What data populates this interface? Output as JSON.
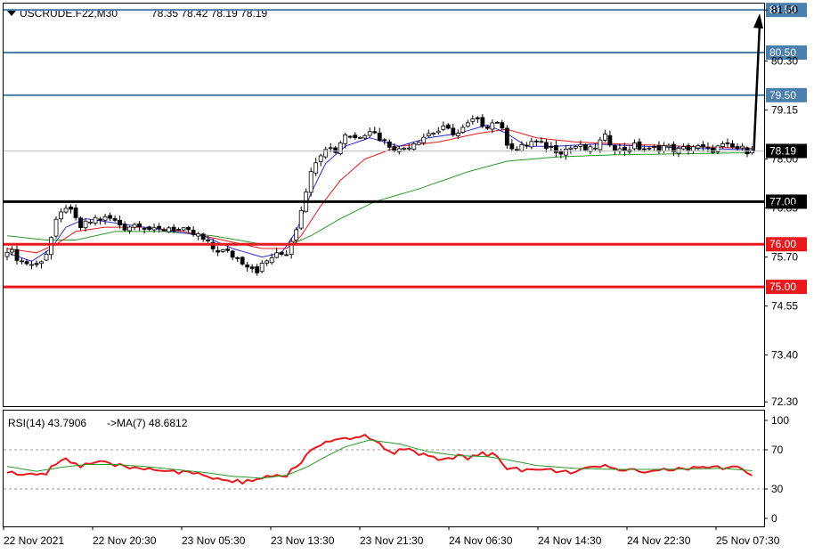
{
  "header": {
    "symbol": "USCRUDE.F22,M30",
    "ohlc": "78.35 78.42 78.19 78.19"
  },
  "rsi_header": {
    "label": "RSI(14) 43.7906",
    "ma_label": "->MA(7) 48.6812"
  },
  "colors": {
    "resistance": "#4a7fae",
    "pivot": "#000000",
    "support": "#e8191c",
    "ma_fast": "#2b2bd6",
    "ma_mid": "#e8191c",
    "ma_slow": "#2a9a2a",
    "rsi": "#e8191c",
    "rsi_ma": "#2a9a2a"
  },
  "chart_data": [
    {
      "type": "candlestick",
      "y_ticks": [
        "81.50",
        "80.30",
        "79.15",
        "78.00",
        "76.85",
        "75.70",
        "74.55",
        "73.40",
        "72.30"
      ],
      "ylim": [
        72.2,
        81.65
      ],
      "x_tick_labels": [
        "22 Nov 2021",
        "22 Nov 20:30",
        "23 Nov 05:30",
        "23 Nov 13:30",
        "23 Nov 21:30",
        "24 Nov 06:30",
        "24 Nov 14:30",
        "24 Nov 22:30",
        "25 Nov 07:30"
      ],
      "levels": [
        {
          "label": "81.50",
          "value": 81.5,
          "kind": "resistance"
        },
        {
          "label": "80.50",
          "value": 80.5,
          "kind": "resistance"
        },
        {
          "label": "79.50",
          "value": 79.5,
          "kind": "resistance"
        },
        {
          "label": "77.00",
          "value": 77.0,
          "kind": "pivot"
        },
        {
          "label": "76.00",
          "value": 76.0,
          "kind": "support"
        },
        {
          "label": "75.00",
          "value": 75.0,
          "kind": "support"
        }
      ],
      "current_price": {
        "label": "78.19",
        "value": 78.19
      },
      "forecast_arrow": {
        "from": 78.19,
        "to": 81.5
      },
      "close_path": [
        [
          0,
          75.9
        ],
        [
          3,
          75.6
        ],
        [
          6,
          75.5
        ],
        [
          8,
          75.8
        ],
        [
          10,
          76.5
        ],
        [
          12,
          76.9
        ],
        [
          15,
          76.4
        ],
        [
          18,
          76.6
        ],
        [
          21,
          76.6
        ],
        [
          24,
          76.4
        ],
        [
          27,
          76.5
        ],
        [
          30,
          76.3
        ],
        [
          33,
          76.4
        ],
        [
          36,
          76.3
        ],
        [
          39,
          76.2
        ],
        [
          42,
          75.9
        ],
        [
          45,
          75.8
        ],
        [
          48,
          75.6
        ],
        [
          51,
          75.4
        ],
        [
          54,
          75.7
        ],
        [
          57,
          75.8
        ],
        [
          59,
          76.4
        ],
        [
          61,
          77.3
        ],
        [
          63,
          78.0
        ],
        [
          65,
          78.3
        ],
        [
          67,
          78.2
        ],
        [
          69,
          78.6
        ],
        [
          71,
          78.5
        ],
        [
          74,
          78.7
        ],
        [
          77,
          78.4
        ],
        [
          80,
          78.2
        ],
        [
          83,
          78.4
        ],
        [
          86,
          78.6
        ],
        [
          89,
          78.7
        ],
        [
          92,
          78.6
        ],
        [
          95,
          78.9
        ],
        [
          98,
          78.8
        ],
        [
          100,
          78.9
        ],
        [
          102,
          78.4
        ],
        [
          104,
          78.2
        ],
        [
          107,
          78.4
        ],
        [
          110,
          78.3
        ],
        [
          113,
          78.2
        ],
        [
          116,
          78.3
        ],
        [
          119,
          78.2
        ],
        [
          122,
          78.5
        ],
        [
          125,
          78.2
        ],
        [
          128,
          78.3
        ],
        [
          131,
          78.2
        ],
        [
          134,
          78.3
        ],
        [
          137,
          78.2
        ],
        [
          140,
          78.3
        ],
        [
          143,
          78.2
        ],
        [
          146,
          78.3
        ],
        [
          149,
          78.25
        ],
        [
          152,
          78.19
        ]
      ],
      "ma_fast_path": [
        [
          0,
          75.8
        ],
        [
          5,
          75.6
        ],
        [
          9,
          75.9
        ],
        [
          12,
          76.4
        ],
        [
          16,
          76.6
        ],
        [
          22,
          76.5
        ],
        [
          28,
          76.4
        ],
        [
          34,
          76.3
        ],
        [
          40,
          76.2
        ],
        [
          46,
          75.9
        ],
        [
          52,
          75.7
        ],
        [
          56,
          75.8
        ],
        [
          59,
          76.3
        ],
        [
          62,
          77.2
        ],
        [
          65,
          77.9
        ],
        [
          69,
          78.3
        ],
        [
          74,
          78.5
        ],
        [
          80,
          78.3
        ],
        [
          86,
          78.5
        ],
        [
          92,
          78.6
        ],
        [
          98,
          78.8
        ],
        [
          102,
          78.6
        ],
        [
          106,
          78.3
        ],
        [
          112,
          78.3
        ],
        [
          120,
          78.35
        ],
        [
          130,
          78.3
        ],
        [
          140,
          78.25
        ],
        [
          152,
          78.22
        ]
      ],
      "ma_mid_path": [
        [
          0,
          75.9
        ],
        [
          6,
          75.8
        ],
        [
          10,
          76.0
        ],
        [
          14,
          76.3
        ],
        [
          20,
          76.4
        ],
        [
          28,
          76.4
        ],
        [
          36,
          76.3
        ],
        [
          44,
          76.1
        ],
        [
          52,
          75.9
        ],
        [
          57,
          75.9
        ],
        [
          60,
          76.2
        ],
        [
          64,
          76.9
        ],
        [
          68,
          77.5
        ],
        [
          73,
          78.0
        ],
        [
          80,
          78.3
        ],
        [
          88,
          78.4
        ],
        [
          96,
          78.6
        ],
        [
          102,
          78.7
        ],
        [
          108,
          78.5
        ],
        [
          116,
          78.4
        ],
        [
          126,
          78.35
        ],
        [
          138,
          78.3
        ],
        [
          152,
          78.25
        ]
      ],
      "ma_slow_path": [
        [
          0,
          76.2
        ],
        [
          8,
          76.1
        ],
        [
          14,
          76.1
        ],
        [
          22,
          76.3
        ],
        [
          32,
          76.3
        ],
        [
          42,
          76.2
        ],
        [
          52,
          76.0
        ],
        [
          58,
          76.0
        ],
        [
          62,
          76.2
        ],
        [
          68,
          76.6
        ],
        [
          75,
          77.0
        ],
        [
          84,
          77.3
        ],
        [
          94,
          77.7
        ],
        [
          102,
          77.95
        ],
        [
          112,
          78.05
        ],
        [
          124,
          78.1
        ],
        [
          136,
          78.12
        ],
        [
          152,
          78.15
        ]
      ]
    },
    {
      "type": "line",
      "title": "RSI(14)",
      "y_ticks": [
        "100",
        "70",
        "30",
        "0"
      ],
      "ylim": [
        0,
        100
      ],
      "levels": [
        70,
        30
      ],
      "rsi_path": [
        [
          0,
          48
        ],
        [
          4,
          43
        ],
        [
          8,
          47
        ],
        [
          10,
          57
        ],
        [
          12,
          61
        ],
        [
          15,
          53
        ],
        [
          18,
          57
        ],
        [
          21,
          55
        ],
        [
          25,
          52
        ],
        [
          30,
          51
        ],
        [
          35,
          47
        ],
        [
          40,
          44
        ],
        [
          44,
          39
        ],
        [
          47,
          37
        ],
        [
          50,
          39
        ],
        [
          54,
          42
        ],
        [
          57,
          44
        ],
        [
          60,
          58
        ],
        [
          62,
          69
        ],
        [
          65,
          77
        ],
        [
          68,
          79
        ],
        [
          71,
          82
        ],
        [
          73,
          86
        ],
        [
          76,
          75
        ],
        [
          79,
          68
        ],
        [
          82,
          70
        ],
        [
          85,
          64
        ],
        [
          88,
          60
        ],
        [
          91,
          63
        ],
        [
          94,
          62
        ],
        [
          97,
          66
        ],
        [
          100,
          64
        ],
        [
          102,
          52
        ],
        [
          105,
          50
        ],
        [
          110,
          49
        ],
        [
          115,
          48
        ],
        [
          120,
          51
        ],
        [
          123,
          53
        ],
        [
          126,
          49
        ],
        [
          130,
          49
        ],
        [
          135,
          50
        ],
        [
          140,
          51
        ],
        [
          145,
          52
        ],
        [
          149,
          53
        ],
        [
          152,
          43.79
        ]
      ],
      "rsi_ma_path": [
        [
          0,
          53
        ],
        [
          6,
          48
        ],
        [
          11,
          52
        ],
        [
          16,
          55
        ],
        [
          22,
          55
        ],
        [
          28,
          53
        ],
        [
          34,
          50
        ],
        [
          40,
          47
        ],
        [
          46,
          43
        ],
        [
          52,
          41
        ],
        [
          57,
          44
        ],
        [
          61,
          52
        ],
        [
          65,
          63
        ],
        [
          69,
          73
        ],
        [
          74,
          80
        ],
        [
          80,
          76
        ],
        [
          86,
          68
        ],
        [
          92,
          64
        ],
        [
          98,
          63
        ],
        [
          102,
          60
        ],
        [
          108,
          54
        ],
        [
          116,
          51
        ],
        [
          124,
          50
        ],
        [
          132,
          50
        ],
        [
          140,
          50.5
        ],
        [
          146,
          51
        ],
        [
          152,
          48.68
        ]
      ]
    }
  ]
}
